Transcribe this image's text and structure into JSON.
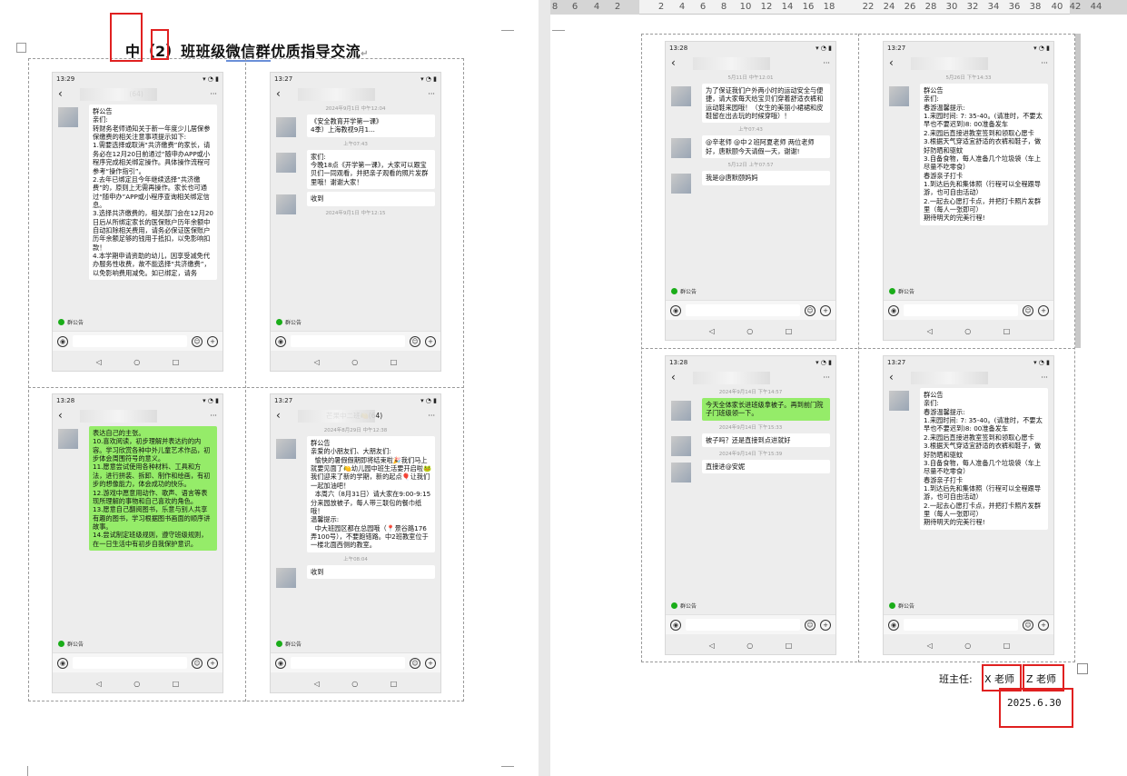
{
  "ruler": {
    "ticks": [
      "8",
      "6",
      "4",
      "2",
      "2",
      "4",
      "6",
      "8",
      "10",
      "12",
      "14",
      "16",
      "18",
      "22",
      "24",
      "26",
      "28",
      "30",
      "32",
      "34",
      "36",
      "38",
      "40",
      "42",
      "44"
    ]
  },
  "page1": {
    "title_pre": "中（2）班班级",
    "title_ul": "微信群",
    "title_post": "优质指导交流",
    "phones": [
      {
        "time": "13:29",
        "header_badge": "(64)",
        "messages": [
          {
            "type": "text",
            "text": "群公告\n亲们:\n转财务老师通知关于新一年度少儿居保参保缴费的相关注意事项提示如下:\n1.需要选择或取消“共济缴费”的家长，请务必在12月20日前通过“随申办APP或小程序完成相关绑定操作。具体操作流程可参考“操作指引”。\n2.去年已绑定且今年继续选择“共济缴费”的，原则上无需再操作。家长也可通过“随申办”APP或小程序查询相关绑定信息。\n3.选择共济缴费的，相关部门会在12月20日后从所绑定家长的医保账户历年余额中自动扣除相关费用，请务必保证医保账户历年余额足够的钱用于抵扣，以免影响扣款！\n4.本学期申请资助的幼儿，因享受减免代办服务性收费，故不能选择“共济缴费”，以免影响费用减免。如已绑定，请务"
          }
        ],
        "tag": "群公告"
      },
      {
        "time": "13:27",
        "header_badge": "",
        "messages": [
          {
            "type": "ts",
            "text": "2024年9月1日 中午12:04"
          },
          {
            "type": "text",
            "text": "《安全教育开学第一课》\n4季）上海教视9月1..."
          },
          {
            "type": "ts",
            "text": "上午07:43"
          },
          {
            "type": "text",
            "text": "家们:\n今晚18点《开学第一课》，大家可以跟宝贝们一同观看，并把亲子观看的照片发群里哦！谢谢大家！"
          },
          {
            "type": "text",
            "text": "收到"
          },
          {
            "type": "ts",
            "text": "2024年9月1日 中午12:15"
          }
        ],
        "tag": "群公告"
      },
      {
        "time": "13:28",
        "header_badge": "",
        "messages": [
          {
            "type": "green",
            "text": "表达自己的主张。\n10.喜欢阅读，初步理解并表达约的内容。学习欣赏各种中外儿童艺术作品，初步体会周围符号的意义。\n11.愿意尝试使用各种材料、工具和方法，进行拼装、拆卸、制作和绘画，有初步的想像能力，体会成功的快乐。\n12.游戏中愿意用动作、歌声、语言等表现所理解的事物和自己喜欢的角色。\n13.愿意自己翻阅图书，乐意与别人共享有趣的图书，学习根据图书画面的顺序讲故事。\n14.尝试制定班级规则，遵守班级规则，在一日生活中有初步自我保护意识。"
          }
        ],
        "tag": "群公告"
      },
      {
        "time": "13:27",
        "header_badge": "芒果中二班🍋(64)",
        "messages": [
          {
            "type": "ts",
            "text": "2024年8月29日 中午12:38"
          },
          {
            "type": "text",
            "text": "群公告\n亲爱的小朋友们、大朋友们:\n  愉快的暑假假期即将结束啦🎉我们马上就要见面了🍋幼儿园中班生活要开启啦🐸我们迎来了新的学期，新的起点🎈让我们一起加油吧！\n  本周六（8月31日）请大家在9:00-9:15分来园放被子，每人带三联包的餐巾纸哦！\n温馨提示:\n  中大班园区都在总园哦（📍景谷路176弄100号），不要跑错路。中2班教室位于一楼北面西侧的教室。"
          },
          {
            "type": "ts",
            "text": "上午08:04"
          },
          {
            "type": "text",
            "text": "收到"
          }
        ],
        "tag": "群公告"
      }
    ]
  },
  "page2": {
    "phones": [
      {
        "time": "13:28",
        "header_badge": "",
        "messages": [
          {
            "type": "ts",
            "text": "5月11日 中午12:01"
          },
          {
            "type": "text",
            "text": "为了保证我们户外两小时的运动安全与便捷，请大家每天给宝贝们穿着舒适衣裤和运动鞋来园哦！（女生的美丽小裙裙和皮鞋留在出去玩的时候穿哦）！"
          },
          {
            "type": "ts",
            "text": "上午07:43"
          },
          {
            "type": "text",
            "text": "@辛老师 @中２班阿夏老师 两位老师好，唐默颐今天请假一天，谢谢!"
          },
          {
            "type": "ts",
            "text": "5月12日 上午07:57"
          },
          {
            "type": "text",
            "text": "我是@唐默颐妈妈"
          }
        ],
        "tag": "群公告"
      },
      {
        "time": "13:27",
        "header_badge": "",
        "messages": [
          {
            "type": "ts",
            "text": "5月26日 下午14:33"
          },
          {
            "type": "text",
            "text": "群公告\n亲们:\n春游温馨提示:\n1.来园时间: 7: 35-40。(请准时，不要太早也不要迟到)8: 00准备发车\n2.来园后直接进教室签到和领取心愿卡\n3.根据天气穿适宜舒适的衣裤和鞋子，做好防晒和驱蚊\n3.自备食物，每人准备几个垃圾袋（车上尽量不吃零食）\n春游亲子打卡\n1.到达后先和集体照（行程可以全程跟导游，也可自由活动）\n2.一起去心愿打卡点，并把打卡照片发群里（每人一张即可）\n期待明天的完美行程!"
          }
        ],
        "tag": "群公告"
      },
      {
        "time": "13:28",
        "header_badge": "",
        "messages": [
          {
            "type": "ts",
            "text": "2024年9月14日 下午14:57"
          },
          {
            "type": "green",
            "text": "今天全体家长进班级拿被子。再到前门院子门班级领一下。"
          },
          {
            "type": "ts",
            "text": "2024年9月14日 下午15:33"
          },
          {
            "type": "text",
            "text": "被子吗？还是直接到点进就好"
          },
          {
            "type": "ts",
            "text": "2024年9月14日 下午15:39"
          },
          {
            "type": "text",
            "text": "直接进@安妮"
          }
        ],
        "tag": "群公告"
      },
      {
        "time": "13:27",
        "header_badge": "",
        "messages": [
          {
            "type": "text",
            "text": "群公告\n亲们:\n春游温馨提示:\n1.来园时间: 7: 35-40。(请准时，不要太早也不要迟到)8: 00准备发车\n2.来园后直接进教室签到和领取心愿卡\n3.根据天气穿适宜舒适的衣裤和鞋子，做好防晒和驱蚊\n3.自备食物，每人准备几个垃圾袋（车上尽量不吃零食）\n春游亲子打卡\n1.到达后先和集体照（行程可以全程跟导游，也可自由活动）\n2.一起去心愿打卡点，并把打卡照片发群里（每人一张即可）\n期待明天的完美行程!"
          }
        ],
        "tag": "群公告"
      }
    ],
    "signature": {
      "label": "班主任:",
      "teacher_x": "X 老师",
      "teacher_z": "Z 老师",
      "date": "2025.6.30"
    }
  },
  "phone_ui": {
    "back": "‹",
    "more": "···",
    "voice": "◉",
    "emoji": "☺",
    "plus": "+",
    "nav_back": "◁",
    "nav_home": "○",
    "nav_recent": "□",
    "status_right": "▾ ◔ ▮"
  },
  "colors": {
    "annotation_red": "#e02020",
    "wechat_green": "#95ec69",
    "phone_bg": "#ededed"
  }
}
